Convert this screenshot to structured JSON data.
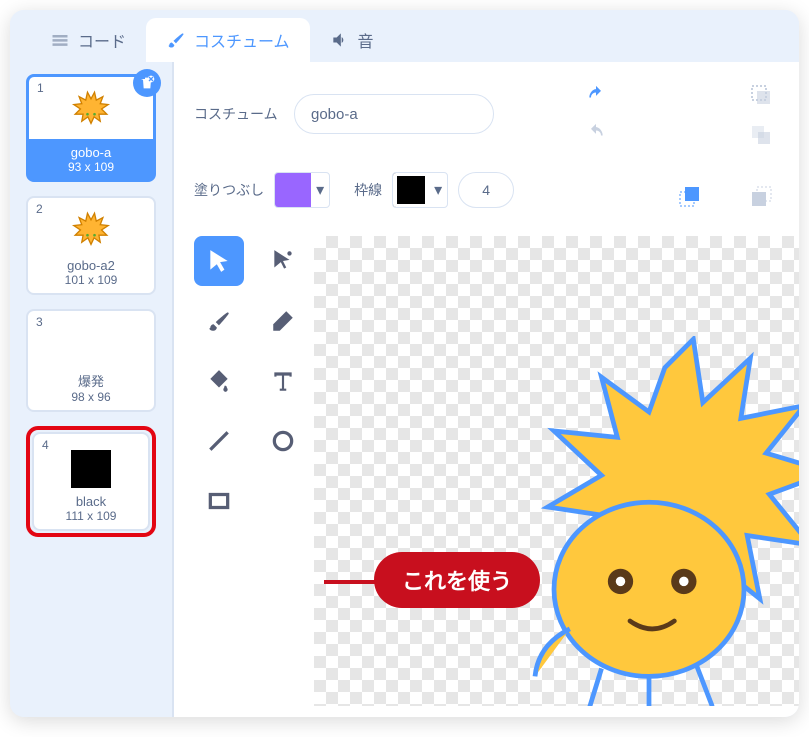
{
  "tabs": {
    "code": "コード",
    "costume": "コスチューム",
    "sound": "音"
  },
  "costumes": [
    {
      "n": "1",
      "name": "gobo-a",
      "dim": "93 x 109"
    },
    {
      "n": "2",
      "name": "gobo-a2",
      "dim": "101 x 109"
    },
    {
      "n": "3",
      "name": "爆発",
      "dim": "98 x 96"
    },
    {
      "n": "4",
      "name": "black",
      "dim": "111 x 109"
    }
  ],
  "editor": {
    "costume_label": "コスチューム",
    "costume_name": "gobo-a",
    "fill_label": "塗りつぶし",
    "stroke_label": "枠線",
    "stroke_width": "4",
    "fill_color": "#9966ff",
    "stroke_color": "#000000"
  },
  "callout": "これを使う",
  "icons": {
    "undo": "undo-icon",
    "redo": "redo-icon",
    "group": "group-icon",
    "ungroup": "ungroup-icon",
    "forward": "forward-icon",
    "backward": "backward-icon"
  }
}
